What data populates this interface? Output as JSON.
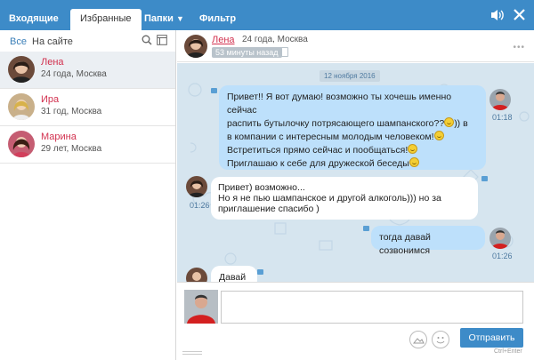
{
  "tabs": [
    {
      "label": "Входящие"
    },
    {
      "label": "Избранные"
    },
    {
      "label": "Папки"
    },
    {
      "label": "Фильтр"
    }
  ],
  "icons": {
    "sound": "speaker-icon",
    "close": "close-icon",
    "search": "search-icon",
    "window": "window-icon"
  },
  "filters": {
    "all": "Все",
    "site": "На сайте"
  },
  "contacts": [
    {
      "name": "Лена",
      "info": "24 года, Москва"
    },
    {
      "name": "Ира",
      "info": "31 год, Москва"
    },
    {
      "name": "Марина",
      "info": "29 лет, Москва"
    }
  ],
  "chat": {
    "name": "Лена",
    "meta": "24 года, Москва",
    "ago": "53 минуты назад",
    "date": "12 ноября 2016"
  },
  "messages": [
    {
      "dir": "out",
      "time": "01:18",
      "lines": [
        "Привет!! Я вот думаю! возможно ты хочешь именно сейчас",
        "распить бутылочку потрясающего шампанского??",
        "в компании с интересным молодым человеком!",
        "Встретиться прямо сейчас и пообщаться!",
        "Приглашаю к себе для дружеской беседы"
      ]
    },
    {
      "dir": "in",
      "time": "01:26",
      "lines": [
        "Привет) возможно...",
        "Но я не пью шампанское и другой алкоголь))) но за",
        "приглашение спасибо )"
      ]
    },
    {
      "dir": "out",
      "time": "01:26",
      "lines": [
        "тогда давай созвонимся"
      ]
    },
    {
      "dir": "in",
      "time": "",
      "lines": [
        "Давай"
      ]
    }
  ],
  "composer": {
    "placeholder": "",
    "send": "Отправить",
    "hint": "Ctrl+Enter"
  },
  "colors": {
    "accent": "#3d8bc8",
    "name": "#d2304e",
    "out_bubble": "#bde0fb",
    "chat_bg": "#d6e5ef"
  }
}
